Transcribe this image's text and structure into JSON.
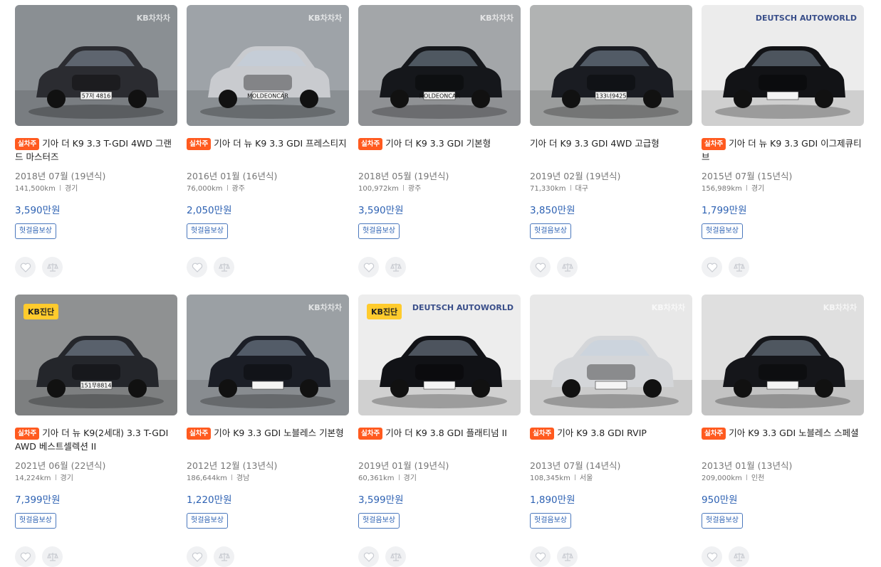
{
  "listings": [
    {
      "title": "기아 더 K9 3.3 T-GDI 4WD 그랜드 마스터즈",
      "badge": "실차주",
      "year": "2018년 07월 (19년식)",
      "mileage": "141,500km",
      "region": "경기",
      "price": "3,590만원",
      "chip": "헛걸음보상",
      "kb": "",
      "watermark": "KB차차차",
      "plate": "57저 4816",
      "color": "#2b2c31",
      "bg": "#8a8f93"
    },
    {
      "title": "기아 더 뉴 K9 3.3 GDI 프레스티지",
      "badge": "실차주",
      "year": "2016년 01월 (16년식)",
      "mileage": "76,000km",
      "region": "광주",
      "price": "2,050만원",
      "chip": "헛걸음보상",
      "kb": "",
      "watermark": "KB차차차",
      "plate": "MOLDEONCAR",
      "color": "#c9cbcf",
      "bg": "#9ea3a8"
    },
    {
      "title": "기아 더 K9 3.3 GDI 기본형",
      "badge": "실차주",
      "year": "2018년 05월 (19년식)",
      "mileage": "100,972km",
      "region": "광주",
      "price": "3,590만원",
      "chip": "헛걸음보상",
      "kb": "",
      "watermark": "KB차차차",
      "plate": "MOLDEONCAR",
      "color": "#15171b",
      "bg": "#a3a6a9"
    },
    {
      "title": "기아 더 K9 3.3 GDI 4WD 고급형",
      "badge": "",
      "year": "2019년 02월 (19년식)",
      "mileage": "71,330km",
      "region": "대구",
      "price": "3,850만원",
      "chip": "헛걸음보상",
      "kb": "",
      "watermark": "",
      "plate": "133너9425",
      "color": "#1a1c22",
      "bg": "#b1b3b3"
    },
    {
      "title": "기아 더 뉴 K9 3.3 GDI 이그제큐티브",
      "badge": "실차주",
      "year": "2015년 07월 (15년식)",
      "mileage": "156,989km",
      "region": "경기",
      "price": "1,799만원",
      "chip": "헛걸음보상",
      "kb": "",
      "watermark": "DEUTSCH AUTOWORLD",
      "plate": "",
      "color": "#121316",
      "bg": "#ececec"
    },
    {
      "title": "기아 더 뉴 K9(2세대) 3.3 T-GDI AWD 베스트셀렉션 II",
      "badge": "실차주",
      "year": "2021년 06월 (22년식)",
      "mileage": "14,224km",
      "region": "경기",
      "price": "7,399만원",
      "chip": "헛걸음보상",
      "kb": "KB진단",
      "watermark": "",
      "plate": "151무8814",
      "color": "#24262b",
      "bg": "#8f9192"
    },
    {
      "title": "기아 K9 3.3 GDI 노블레스 기본형",
      "badge": "실차주",
      "year": "2012년 12월 (13년식)",
      "mileage": "186,644km",
      "region": "경남",
      "price": "1,220만원",
      "chip": "헛걸음보상",
      "kb": "",
      "watermark": "KB차차차",
      "plate": "",
      "color": "#1b1e26",
      "bg": "#9ba0a4"
    },
    {
      "title": "기아 더 K9 3.8 GDI 플래티넘 II",
      "badge": "실차주",
      "year": "2019년 01월 (19년식)",
      "mileage": "60,361km",
      "region": "경기",
      "price": "3,599만원",
      "chip": "헛걸음보상",
      "kb": "KB진단",
      "watermark": "DEUTSCH AUTOWORLD",
      "plate": "",
      "color": "#111216",
      "bg": "#ededed"
    },
    {
      "title": "기아 K9 3.8 GDI RVIP",
      "badge": "실차주",
      "year": "2013년 07월 (14년식)",
      "mileage": "108,345km",
      "region": "서울",
      "price": "1,890만원",
      "chip": "헛걸음보상",
      "kb": "",
      "watermark": "KB차차차",
      "plate": "",
      "color": "#d4d6d9",
      "bg": "#e8e8e8"
    },
    {
      "title": "기아 K9 3.3 GDI 노블레스 스페셜",
      "badge": "실차주",
      "year": "2013년 01월 (13년식)",
      "mileage": "209,000km",
      "region": "인천",
      "price": "950만원",
      "chip": "헛걸음보상",
      "kb": "",
      "watermark": "KB차차차",
      "plate": "",
      "color": "#15161a",
      "bg": "#dfdfdf"
    }
  ],
  "icons": {
    "like": "heart-icon",
    "compare": "scale-icon"
  }
}
